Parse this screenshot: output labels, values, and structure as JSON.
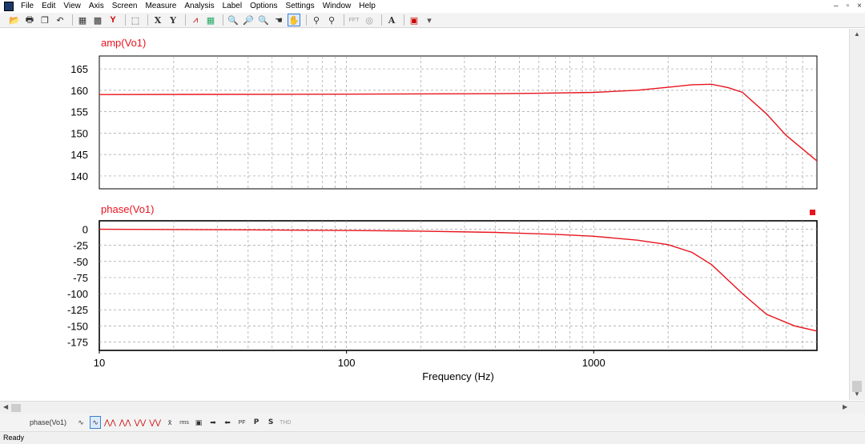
{
  "menu": [
    "File",
    "Edit",
    "View",
    "Axis",
    "Screen",
    "Measure",
    "Analysis",
    "Label",
    "Options",
    "Settings",
    "Window",
    "Help"
  ],
  "window_controls": [
    "–",
    "▫",
    "×"
  ],
  "toolbar_icons": [
    "open-icon",
    "print-icon",
    "copy-icon",
    "undo-icon",
    "data-icon",
    "save-graph-icon",
    "y-axis-icon",
    "select-icon",
    "x-label-icon",
    "y-label-icon",
    "alt-icon",
    "grid-icon",
    "zoom-in-icon",
    "zoom-region-icon",
    "zoom-out-icon",
    "pan-icon",
    "hand-icon",
    "probe-icon",
    "probe-multi-icon",
    "fft-icon",
    "target-icon",
    "text-icon",
    "color-icon",
    "dropdown-icon"
  ],
  "toolbar_text": {
    "x": "X",
    "y": "Y",
    "a": "A"
  },
  "plots": {
    "amp": {
      "title": "amp(Vo1)",
      "color": "#e8141e"
    },
    "phase": {
      "title": "phase(Vo1)",
      "color": "#e8141e"
    }
  },
  "chart_data": [
    {
      "type": "line",
      "title": "amp(Vo1)",
      "xlabel": "Frequency (Hz)",
      "ylabel": "",
      "x_scale": "log",
      "xlim": [
        10,
        8000
      ],
      "ylim": [
        137,
        168
      ],
      "y_ticks": [
        140,
        145,
        150,
        155,
        160,
        165
      ],
      "grid": true,
      "series": [
        {
          "name": "amp(Vo1)",
          "x": [
            10,
            100,
            400,
            600,
            1000,
            1500,
            2000,
            2500,
            3000,
            3500,
            4000,
            5000,
            6000,
            8000
          ],
          "y": [
            159.0,
            159.1,
            159.2,
            159.3,
            159.5,
            160.0,
            160.7,
            161.3,
            161.4,
            160.6,
            159.5,
            154.5,
            149.5,
            143.5
          ]
        }
      ]
    },
    {
      "type": "line",
      "title": "phase(Vo1)",
      "xlabel": "Frequency (Hz)",
      "ylabel": "",
      "x_scale": "log",
      "xlim": [
        10,
        8000
      ],
      "ylim": [
        -188,
        13
      ],
      "y_ticks": [
        0,
        -25,
        -50,
        -75,
        -100,
        -125,
        -150,
        -175
      ],
      "grid": true,
      "series": [
        {
          "name": "phase(Vo1)",
          "x": [
            10,
            40,
            100,
            200,
            400,
            700,
            1000,
            1500,
            2000,
            2500,
            3000,
            4000,
            5000,
            6500,
            8000
          ],
          "y": [
            0,
            -1,
            -2,
            -3,
            -5,
            -8,
            -11,
            -17,
            -24,
            -36,
            -55,
            -100,
            -132,
            -150,
            -158
          ]
        }
      ]
    }
  ],
  "x_tick_labels": [
    "10",
    "100",
    "1000"
  ],
  "x_axis_label": "Frequency (Hz)",
  "bottom_toolbar": {
    "tab_label": "phase(Vo1)",
    "buttons": [
      "∿",
      "∿",
      "⋀⋀",
      "⋀⋀",
      "⋁⋁",
      "⋁⋁",
      "x̄",
      "rms",
      "▣",
      "➡",
      "⬅",
      "PF",
      "P",
      "S",
      "THD"
    ]
  },
  "status_text": "Ready"
}
